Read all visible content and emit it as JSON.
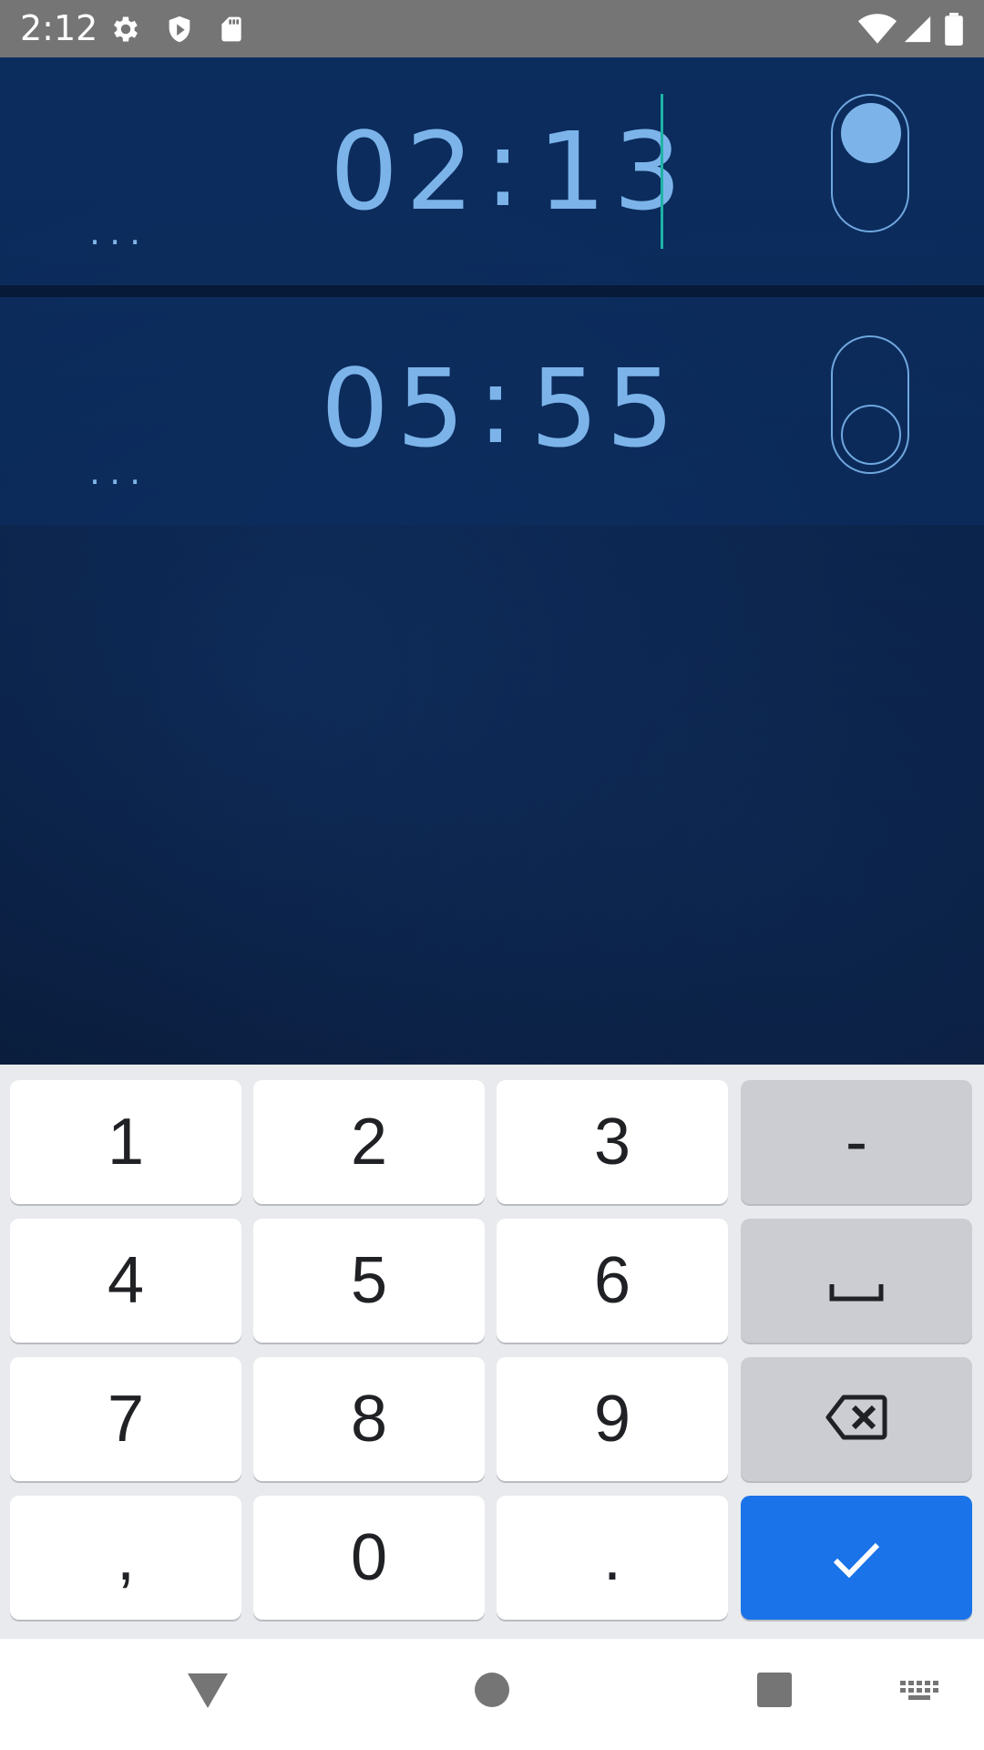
{
  "status_bar": {
    "time": "2:12",
    "icons": [
      "settings-icon",
      "shield-icon",
      "sd-card-icon",
      "wifi-icon",
      "signal-icon",
      "battery-icon"
    ]
  },
  "alarms": [
    {
      "time_hh": "02",
      "time_mm": "13",
      "separator": ":",
      "more": "...",
      "enabled": true
    },
    {
      "time_hh": "05",
      "time_mm": "55",
      "separator": ":",
      "more": "...",
      "enabled": false
    }
  ],
  "keyboard": {
    "rows": [
      [
        "1",
        "2",
        "3",
        "-"
      ],
      [
        "4",
        "5",
        "6",
        "space-icon"
      ],
      [
        "7",
        "8",
        "9",
        "backspace-icon"
      ],
      [
        ",",
        "0",
        ".",
        "checkmark-icon"
      ]
    ],
    "enter_color": "#1a73e8"
  },
  "nav_bar": {
    "icons": [
      "back-icon",
      "home-icon",
      "recents-icon",
      "keyboard-switch-icon"
    ]
  },
  "colors": {
    "accent": "#7cb4ea",
    "cursor": "#1fb3a6"
  }
}
